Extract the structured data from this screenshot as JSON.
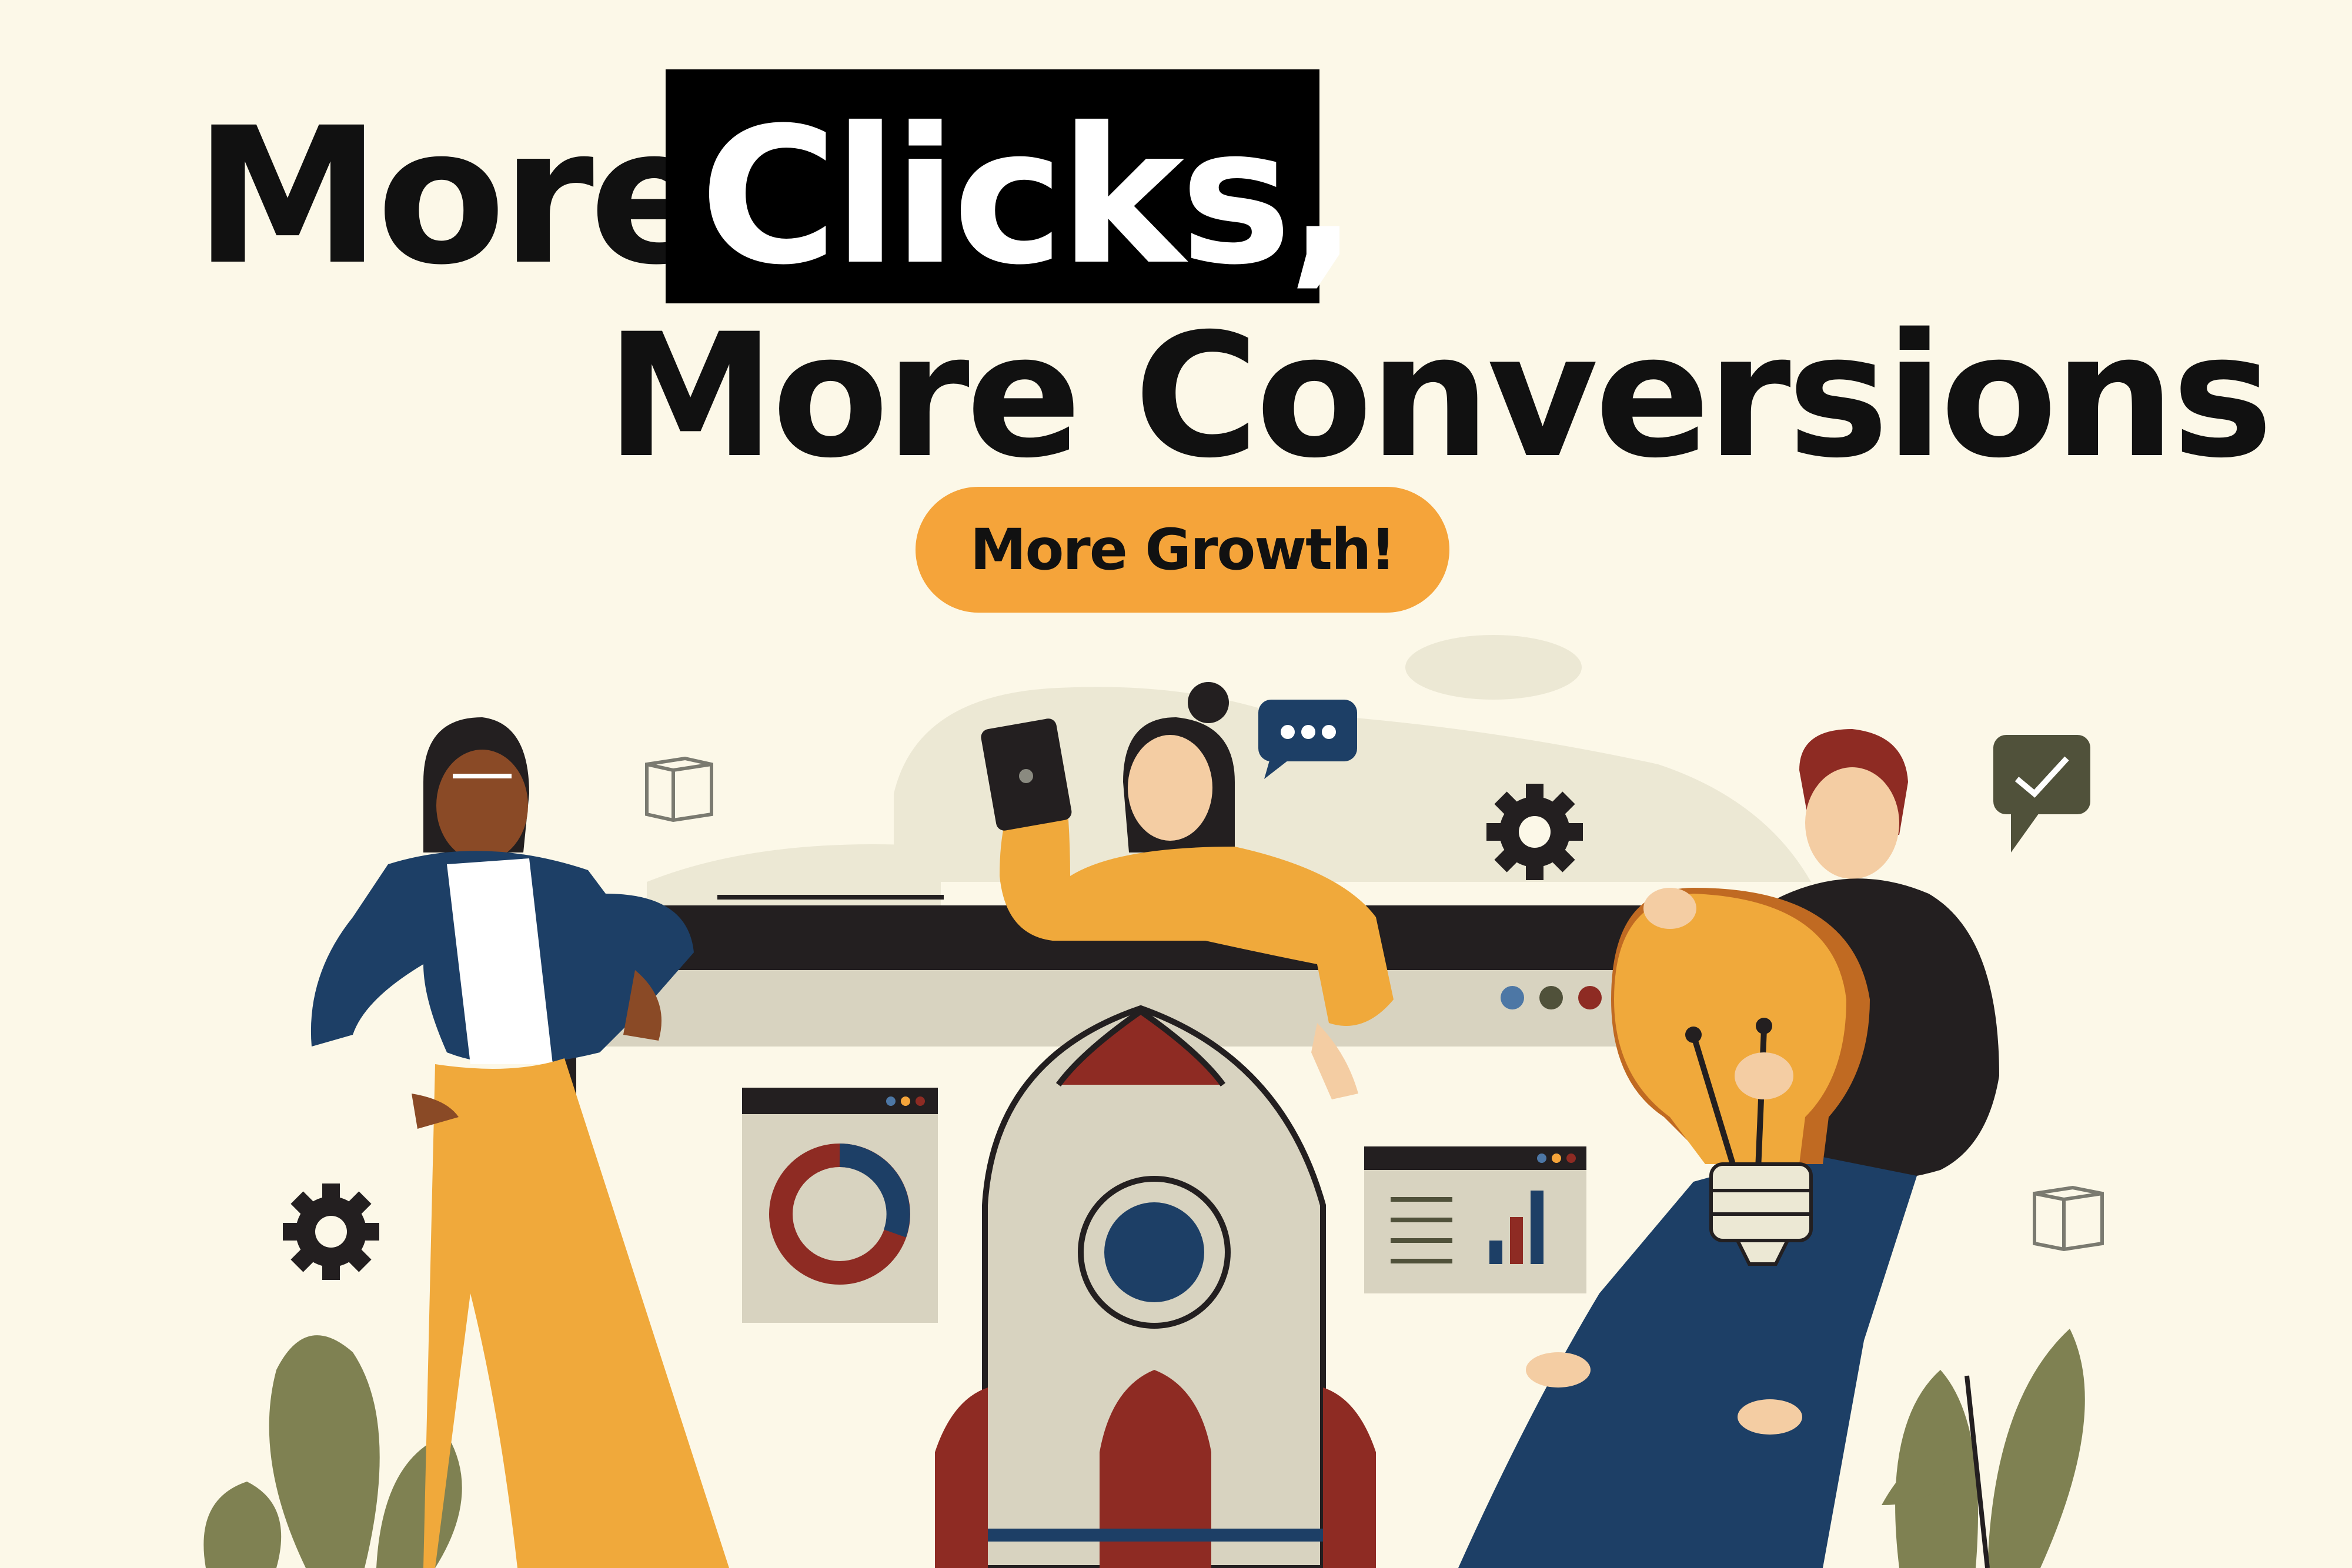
{
  "headline": {
    "word_more": "More",
    "word_clicks": "Clicks,",
    "line2": "More Conversions"
  },
  "cta": {
    "label": "More Growth!"
  },
  "colors": {
    "background": "#fcf8e8",
    "accent_orange": "#f5a43a",
    "navy": "#1d3f66",
    "rust": "#8e2b23",
    "olive": "#7f8152",
    "dark": "#231f20"
  },
  "icons": [
    "gear-icon",
    "cube-icon",
    "chat-bubble-icon",
    "check-bubble-icon",
    "rocket-icon",
    "lightbulb-icon",
    "donut-chart-icon",
    "bar-chart-icon",
    "leaf-icon"
  ]
}
